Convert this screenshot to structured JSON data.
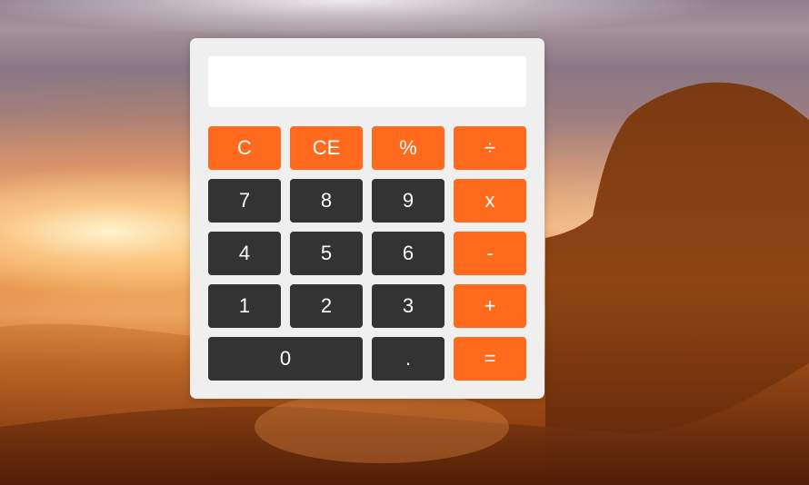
{
  "calculator": {
    "display_value": "",
    "keys": {
      "clear": "C",
      "clear_entry": "CE",
      "percent": "%",
      "divide": "÷",
      "seven": "7",
      "eight": "8",
      "nine": "9",
      "multiply": "x",
      "four": "4",
      "five": "5",
      "six": "6",
      "subtract": "-",
      "one": "1",
      "two": "2",
      "three": "3",
      "add": "+",
      "zero": "0",
      "decimal": ".",
      "equals": "="
    }
  },
  "colors": {
    "operator_key": "#ff6a1c",
    "number_key": "#333333",
    "panel": "#efefef",
    "display": "#ffffff"
  }
}
